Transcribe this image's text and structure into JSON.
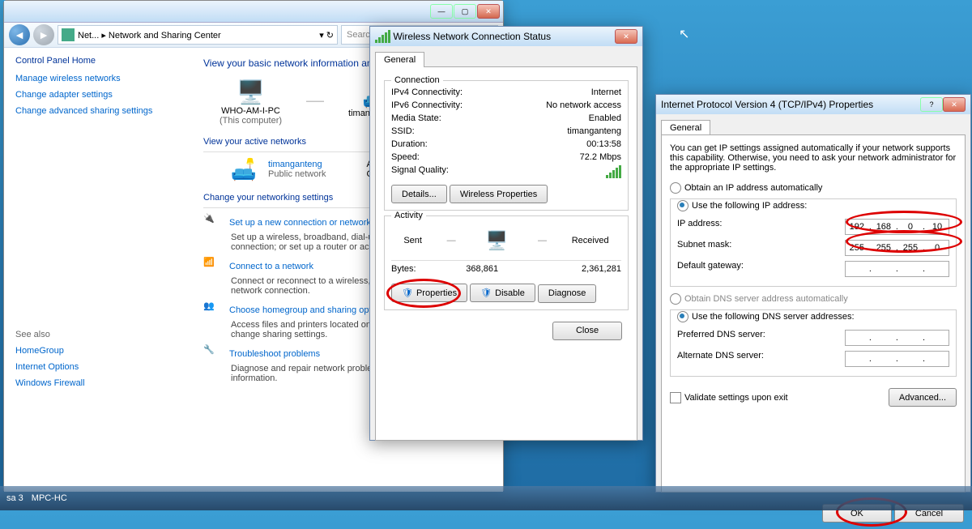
{
  "cp": {
    "breadcrumb": "Net...  ▸  Network and Sharing Center",
    "search_placeholder": "Search Control Panel",
    "home": "Control Panel Home",
    "side": [
      "Manage wireless networks",
      "Change adapter settings",
      "Change advanced sharing settings"
    ],
    "seealso_hdr": "See also",
    "seealso": [
      "HomeGroup",
      "Internet Options",
      "Windows Firewall"
    ],
    "heading": "View your basic network information and set up connections",
    "pc": "WHO-AM-I-PC",
    "pc_sub": "(This computer)",
    "net": "timanganteng",
    "view_active": "View your active networks",
    "acc": "Acc",
    "con": "Con",
    "active_name": "timanganteng",
    "active_type": "Public network",
    "change_hdr": "Change your networking settings",
    "opt1": "Set up a new connection or network",
    "opt1d": "Set up a wireless, broadband, dial-up, ad hoc, or VPN connection; or set up a router or access point.",
    "opt2": "Connect to a network",
    "opt2d": "Connect or reconnect to a wireless, wired, dial-up, or VPN network connection.",
    "opt3": "Choose homegroup and sharing options",
    "opt3d": "Access files and printers located on other network computers, or change sharing settings.",
    "opt4": "Troubleshoot problems",
    "opt4d": "Diagnose and repair network problems, or get troubleshooting information."
  },
  "status": {
    "title": "Wireless Network Connection Status",
    "tab": "General",
    "grp_conn": "Connection",
    "ipv4": "IPv4 Connectivity:",
    "ipv4v": "Internet",
    "ipv6": "IPv6 Connectivity:",
    "ipv6v": "No network access",
    "media": "Media State:",
    "mediav": "Enabled",
    "ssid": "SSID:",
    "ssidv": "timanganteng",
    "dur": "Duration:",
    "durv": "00:13:58",
    "speed": "Speed:",
    "speedv": "72.2 Mbps",
    "sigq": "Signal Quality:",
    "details": "Details...",
    "wprops": "Wireless Properties",
    "grp_act": "Activity",
    "sent": "Sent",
    "recv": "Received",
    "bytes": "Bytes:",
    "sentv": "368,861",
    "recvv": "2,361,281",
    "props": "Properties",
    "disable": "Disable",
    "diag": "Diagnose",
    "close": "Close"
  },
  "ipv4": {
    "title": "Internet Protocol Version 4 (TCP/IPv4) Properties",
    "tab": "General",
    "intro": "You can get IP settings assigned automatically if your network supports this capability. Otherwise, you need to ask your network administrator for the appropriate IP settings.",
    "r1": "Obtain an IP address automatically",
    "r2": "Use the following IP address:",
    "ip_l": "IP address:",
    "ip": [
      "192",
      "168",
      "0",
      "10"
    ],
    "sm_l": "Subnet mask:",
    "sm": [
      "255",
      "255",
      "255",
      "0"
    ],
    "gw_l": "Default gateway:",
    "gw": [
      "",
      "",
      "",
      ""
    ],
    "r3": "Obtain DNS server address automatically",
    "r4": "Use the following DNS server addresses:",
    "p_l": "Preferred DNS server:",
    "a_l": "Alternate DNS server:",
    "validate": "Validate settings upon exit",
    "adv": "Advanced...",
    "ok": "OK",
    "cancel": "Cancel"
  },
  "taskbar": {
    "app1": "sa 3",
    "app2": "MPC-HC"
  }
}
